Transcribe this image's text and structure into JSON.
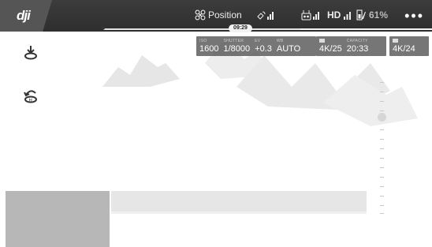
{
  "topbar": {
    "logo": "dji",
    "flight_mode": "Position",
    "hd_label": "HD",
    "battery_percent": "61%",
    "timer": "09:29"
  },
  "camera_params": [
    {
      "label": "ISO",
      "value": "1600"
    },
    {
      "label": "SHUTTER",
      "value": "1/8000"
    },
    {
      "label": "EV",
      "value": "+0.3"
    },
    {
      "label": "WB",
      "value": "AUTO"
    }
  ],
  "capacity": {
    "resolution": "4K/25",
    "label": "CAPACITY",
    "value": "20:33"
  },
  "video_format": {
    "value": "4K/24"
  },
  "side_buttons": [
    "auto-takeoff-icon",
    "return-to-home-icon"
  ],
  "icons": [
    "dji-logo",
    "aircraft-icon",
    "satellite-icon",
    "remote-signal-icon",
    "hd-signal-icon",
    "battery-icon",
    "more-icon",
    "camera-icon"
  ],
  "colors": {
    "topbar": "#333333",
    "panel": "#505050",
    "thumb": "#b7b7b7"
  }
}
